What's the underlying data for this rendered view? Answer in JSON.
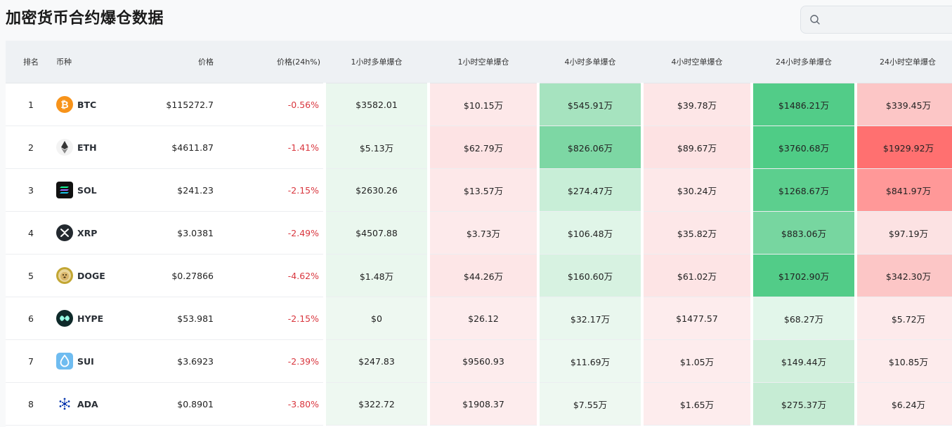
{
  "page": {
    "title": "加密货币合约爆仓数据"
  },
  "search": {
    "placeholder": "",
    "value": ""
  },
  "table": {
    "headers": {
      "rank": "排名",
      "coin": "币种",
      "price": "价格",
      "change": "价格(24h%)",
      "long_1h": "1小时多单爆仓",
      "short_1h": "1小时空单爆仓",
      "long_4h": "4小时多单爆仓",
      "short_4h": "4小时空单爆仓",
      "long_24h": "24小时多单爆仓",
      "short_24h": "24小时空单爆仓"
    },
    "rows": [
      {
        "rank": "1",
        "symbol": "BTC",
        "icon": "bitcoin-icon",
        "price": "$115272.7",
        "change": "-0.56%",
        "long_1h": "$3582.01",
        "short_1h": "$10.15万",
        "long_4h": "$545.91万",
        "short_4h": "$39.78万",
        "long_24h": "$1486.21万",
        "short_24h": "$339.45万"
      },
      {
        "rank": "2",
        "symbol": "ETH",
        "icon": "ethereum-icon",
        "price": "$4611.87",
        "change": "-1.41%",
        "long_1h": "$5.13万",
        "short_1h": "$62.79万",
        "long_4h": "$826.06万",
        "short_4h": "$89.67万",
        "long_24h": "$3760.68万",
        "short_24h": "$1929.92万"
      },
      {
        "rank": "3",
        "symbol": "SOL",
        "icon": "solana-icon",
        "price": "$241.23",
        "change": "-2.15%",
        "long_1h": "$2630.26",
        "short_1h": "$13.57万",
        "long_4h": "$274.47万",
        "short_4h": "$30.24万",
        "long_24h": "$1268.67万",
        "short_24h": "$841.97万"
      },
      {
        "rank": "4",
        "symbol": "XRP",
        "icon": "xrp-icon",
        "price": "$3.0381",
        "change": "-2.49%",
        "long_1h": "$4507.88",
        "short_1h": "$3.73万",
        "long_4h": "$106.48万",
        "short_4h": "$35.82万",
        "long_24h": "$883.06万",
        "short_24h": "$97.19万"
      },
      {
        "rank": "5",
        "symbol": "DOGE",
        "icon": "dogecoin-icon",
        "price": "$0.27866",
        "change": "-4.62%",
        "long_1h": "$1.48万",
        "short_1h": "$44.26万",
        "long_4h": "$160.60万",
        "short_4h": "$61.02万",
        "long_24h": "$1702.90万",
        "short_24h": "$342.30万"
      },
      {
        "rank": "6",
        "symbol": "HYPE",
        "icon": "hyperliquid-icon",
        "price": "$53.981",
        "change": "-2.15%",
        "long_1h": "$0",
        "short_1h": "$26.12",
        "long_4h": "$32.17万",
        "short_4h": "$1477.57",
        "long_24h": "$68.27万",
        "short_24h": "$5.72万"
      },
      {
        "rank": "7",
        "symbol": "SUI",
        "icon": "sui-icon",
        "price": "$3.6923",
        "change": "-2.39%",
        "long_1h": "$247.83",
        "short_1h": "$9560.93",
        "long_4h": "$11.69万",
        "short_4h": "$1.05万",
        "long_24h": "$149.44万",
        "short_24h": "$10.85万"
      },
      {
        "rank": "8",
        "symbol": "ADA",
        "icon": "cardano-icon",
        "price": "$0.8901",
        "change": "-3.80%",
        "long_1h": "$322.72",
        "short_1h": "$1908.37",
        "long_4h": "$7.55万",
        "short_4h": "$1.65万",
        "long_24h": "$275.37万",
        "short_24h": "$6.24万"
      }
    ]
  },
  "colors": {
    "negative_change": "#d9363e",
    "long_scale_light": "#eaf7ee",
    "long_scale_dark": "#4fcc86",
    "short_scale_light": "#fdeced",
    "short_scale_dark": "#ff7070",
    "header_bg": "#eef1f4"
  }
}
